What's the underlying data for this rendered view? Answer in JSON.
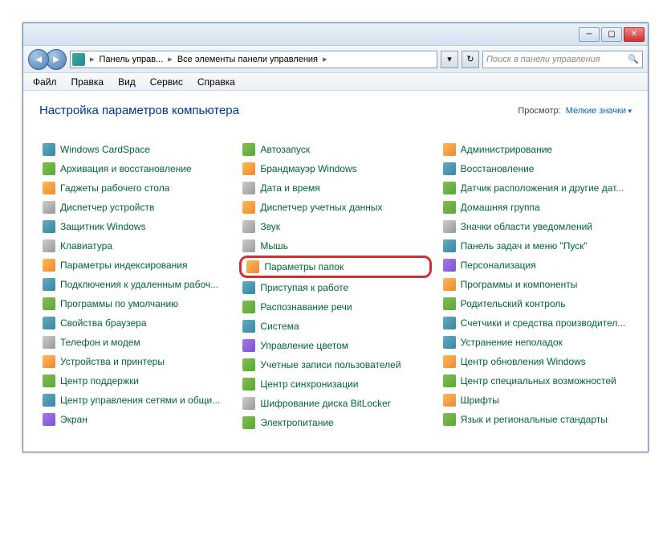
{
  "breadcrumb": {
    "seg1": "Панель управ...",
    "seg2": "Все элементы панели управления"
  },
  "search": {
    "placeholder": "Поиск в панели управления"
  },
  "menu": {
    "file": "Файл",
    "edit": "Правка",
    "view": "Вид",
    "service": "Сервис",
    "help": "Справка"
  },
  "header": {
    "title": "Настройка параметров компьютера",
    "viewlabel": "Просмотр:",
    "viewmode": "Мелкие значки"
  },
  "items": {
    "col1": [
      {
        "label": "Windows CardSpace",
        "ic": "ic-a"
      },
      {
        "label": "Архивация и восстановление",
        "ic": "ic-b"
      },
      {
        "label": "Гаджеты рабочего стола",
        "ic": "ic-c"
      },
      {
        "label": "Диспетчер устройств",
        "ic": "ic-e"
      },
      {
        "label": "Защитник Windows",
        "ic": "ic-a"
      },
      {
        "label": "Клавиатура",
        "ic": "ic-e"
      },
      {
        "label": "Параметры индексирования",
        "ic": "ic-c"
      },
      {
        "label": "Подключения к удаленным рабоч...",
        "ic": "ic-a"
      },
      {
        "label": "Программы по умолчанию",
        "ic": "ic-b"
      },
      {
        "label": "Свойства браузера",
        "ic": "ic-a"
      },
      {
        "label": "Телефон и модем",
        "ic": "ic-e"
      },
      {
        "label": "Устройства и принтеры",
        "ic": "ic-c"
      },
      {
        "label": "Центр поддержки",
        "ic": "ic-b"
      },
      {
        "label": "Центр управления сетями и общи...",
        "ic": "ic-a"
      },
      {
        "label": "Экран",
        "ic": "ic-d"
      }
    ],
    "col2": [
      {
        "label": "Автозапуск",
        "ic": "ic-b"
      },
      {
        "label": "Брандмауэр Windows",
        "ic": "ic-c"
      },
      {
        "label": "Дата и время",
        "ic": "ic-e"
      },
      {
        "label": "Диспетчер учетных данных",
        "ic": "ic-c"
      },
      {
        "label": "Звук",
        "ic": "ic-e"
      },
      {
        "label": "Мышь",
        "ic": "ic-e"
      },
      {
        "label": "Параметры папок",
        "ic": "ic-c",
        "hl": true
      },
      {
        "label": "Приступая к работе",
        "ic": "ic-a"
      },
      {
        "label": "Распознавание речи",
        "ic": "ic-b"
      },
      {
        "label": "Система",
        "ic": "ic-a"
      },
      {
        "label": "Управление цветом",
        "ic": "ic-d"
      },
      {
        "label": "Учетные записи пользователей",
        "ic": "ic-b"
      },
      {
        "label": "Центр синхронизации",
        "ic": "ic-b"
      },
      {
        "label": "Шифрование диска BitLocker",
        "ic": "ic-e"
      },
      {
        "label": "Электропитание",
        "ic": "ic-b"
      }
    ],
    "col3": [
      {
        "label": "Администрирование",
        "ic": "ic-c"
      },
      {
        "label": "Восстановление",
        "ic": "ic-a"
      },
      {
        "label": "Датчик расположения и другие дат...",
        "ic": "ic-b"
      },
      {
        "label": "Домашняя группа",
        "ic": "ic-b"
      },
      {
        "label": "Значки области уведомлений",
        "ic": "ic-e"
      },
      {
        "label": "Панель задач и меню \"Пуск\"",
        "ic": "ic-a"
      },
      {
        "label": "Персонализация",
        "ic": "ic-d"
      },
      {
        "label": "Программы и компоненты",
        "ic": "ic-c"
      },
      {
        "label": "Родительский контроль",
        "ic": "ic-b"
      },
      {
        "label": "Счетчики и средства производител...",
        "ic": "ic-a"
      },
      {
        "label": "Устранение неполадок",
        "ic": "ic-a"
      },
      {
        "label": "Центр обновления Windows",
        "ic": "ic-c"
      },
      {
        "label": "Центр специальных возможностей",
        "ic": "ic-b"
      },
      {
        "label": "Шрифты",
        "ic": "ic-c"
      },
      {
        "label": "Язык и региональные стандарты",
        "ic": "ic-b"
      }
    ]
  }
}
